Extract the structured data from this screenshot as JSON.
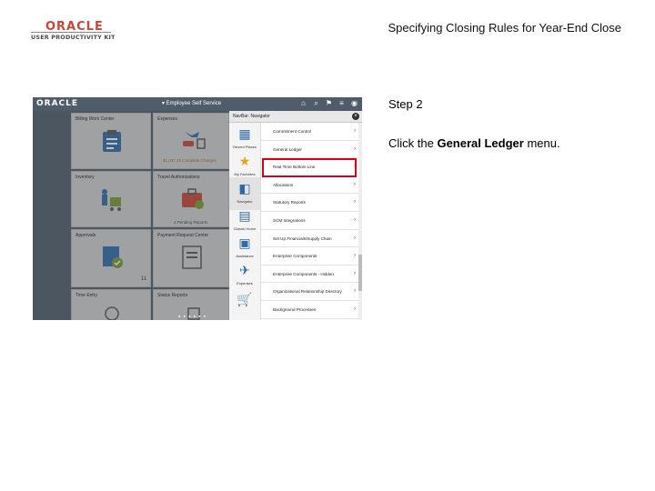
{
  "slide": {
    "logo": {
      "brand": "ORACLE",
      "product": "USER PRODUCTIVITY KIT"
    },
    "title": "Specifying Closing Rules for Year-End Close",
    "step": "Step 2",
    "instruction": {
      "prefix": "Click the ",
      "bold": "General Ledger",
      "suffix": " menu."
    }
  },
  "screenshot": {
    "header": {
      "logo": "ORACLE",
      "title": "▾ Employee Self Service",
      "icons": [
        "home-icon",
        "search-icon",
        "flag-icon",
        "menu-icon",
        "nav-compass-icon"
      ]
    },
    "tiles": [
      {
        "title": "Billing Work Center",
        "icon": "clipboard-icon"
      },
      {
        "title": "Expenses",
        "icon": "travel-icon",
        "sub": "$1,037.23 Complete Charges"
      },
      {
        "title": "Inventory",
        "icon": "inventory-icon"
      },
      {
        "title": "Travel Authorizations",
        "icon": "briefcase-icon",
        "sub": "2 Pending Reports"
      },
      {
        "title": "Approvals",
        "icon": "approvals-icon",
        "sub": "11"
      },
      {
        "title": "Payment Request Center",
        "icon": "payment-icon"
      },
      {
        "title": "Time Entry",
        "icon": "time-icon"
      },
      {
        "title": "Status Reports",
        "icon": "status-icon"
      }
    ],
    "navigator": {
      "header": "NavBar: Navigator",
      "rail": [
        {
          "label": "Recent Places",
          "icon": "recent-places-icon"
        },
        {
          "label": "My Favorites",
          "icon": "star-icon"
        },
        {
          "label": "Navigator",
          "icon": "navigator-icon"
        },
        {
          "label": "Classic Home",
          "icon": "classic-home-icon"
        },
        {
          "label": "Assistance",
          "icon": "assistance-icon"
        },
        {
          "label": "Expenses",
          "icon": "expenses-icon"
        },
        {
          "label": "",
          "icon": "cart-icon"
        }
      ],
      "items": [
        "Commitment Control",
        "General Ledger",
        "Real Time Bottom Line",
        "Allocations",
        "Statutory Reports",
        "SCM Integrations",
        "Set Up Financials/Supply Chain",
        "Enterprise Components",
        "Enterprise Components - Hidden",
        "Organizational Relationship Directory",
        "Background Processes"
      ],
      "selected_index": 1
    },
    "page_dots": "● ● ● ● ● ●"
  }
}
